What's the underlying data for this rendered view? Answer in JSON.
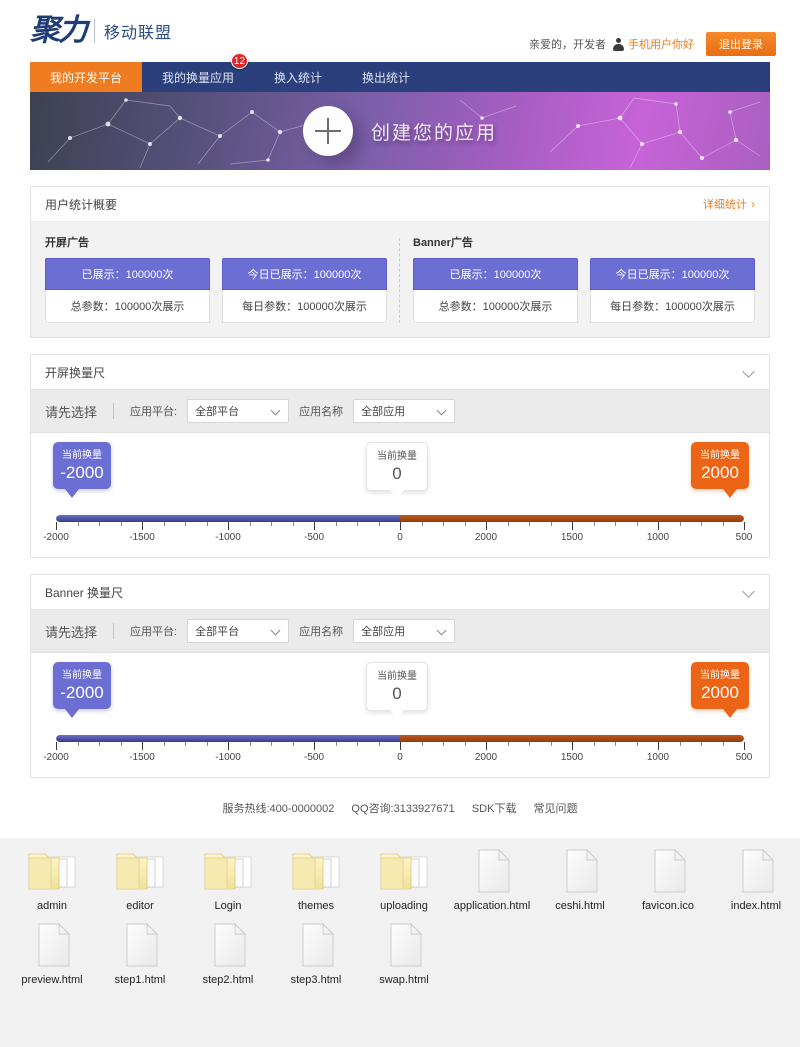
{
  "header": {
    "logo_mark": "聚力",
    "logo_sub": "移动联盟",
    "greeting": "亲爱的，开发者",
    "username": "手机用户你好",
    "logout_label": "退出登录",
    "avatar_icon": "user-avatar-icon"
  },
  "nav": {
    "items": [
      {
        "label": "我的开发平台",
        "active": true,
        "badge": ""
      },
      {
        "label": "我的换量应用",
        "active": false,
        "badge": "12"
      },
      {
        "label": "换入统计",
        "active": false,
        "badge": ""
      },
      {
        "label": "换出统计",
        "active": false,
        "badge": ""
      }
    ]
  },
  "hero": {
    "plus_icon": "plus-circle-icon",
    "text": "创建您的应用"
  },
  "stats": {
    "title": "用户统计概要",
    "more_label": "详细统计",
    "more_icon": "chevron-right-icon",
    "groups": [
      {
        "label": "开屏广告",
        "boxes": [
          {
            "top": "已展示：100000次",
            "bottom": "总参数：100000次展示"
          },
          {
            "top": "今日已展示：100000次",
            "bottom": "每日参数：100000次展示"
          }
        ]
      },
      {
        "label": "Banner广告",
        "boxes": [
          {
            "top": "已展示：100000次",
            "bottom": "总参数：100000次展示"
          },
          {
            "top": "今日已展示：100000次",
            "bottom": "每日参数：100000次展示"
          }
        ]
      }
    ]
  },
  "sections": [
    {
      "title": "开屏换量尺",
      "collapse_icon": "chevron-down-icon",
      "filters": {
        "title": "请先选择",
        "platform_label": "应用平台:",
        "platform_value": "全部平台",
        "app_label": "应用名称",
        "app_value": "全部应用",
        "dropdown_icon": "chevron-down-icon"
      },
      "slider": {
        "bubbles": [
          {
            "label": "当前换量",
            "value": "-2000",
            "color": "blue"
          },
          {
            "label": "当前换量",
            "value": "0",
            "color": "white"
          },
          {
            "label": "当前换量",
            "value": "2000",
            "color": "orange"
          }
        ],
        "tick_labels": [
          "-2000",
          "-1500",
          "-1000",
          "-500",
          "0",
          "2000",
          "1500",
          "1000",
          "500"
        ],
        "track_left_color": "#3a3e86",
        "track_right_color": "#8e3d0e"
      }
    },
    {
      "title": "Banner 换量尺",
      "collapse_icon": "chevron-down-icon",
      "filters": {
        "title": "请先选择",
        "platform_label": "应用平台:",
        "platform_value": "全部平台",
        "app_label": "应用名称",
        "app_value": "全部应用",
        "dropdown_icon": "chevron-down-icon"
      },
      "slider": {
        "bubbles": [
          {
            "label": "当前换量",
            "value": "-2000",
            "color": "blue"
          },
          {
            "label": "当前换量",
            "value": "0",
            "color": "white"
          },
          {
            "label": "当前换量",
            "value": "2000",
            "color": "orange"
          }
        ],
        "tick_labels": [
          "-2000",
          "-1500",
          "-1000",
          "-500",
          "0",
          "2000",
          "1500",
          "1000",
          "500"
        ],
        "track_left_color": "#3a3e86",
        "track_right_color": "#8e3d0e"
      }
    }
  ],
  "footer": {
    "hotline": "服务热线:400-0000002",
    "qq": "QQ咨询:3133927671",
    "sdk": "SDK下载",
    "faq": "常见问题"
  },
  "desktop": {
    "row1": [
      {
        "name": "admin",
        "type": "folder"
      },
      {
        "name": "editor",
        "type": "folder"
      },
      {
        "name": "Login",
        "type": "folder"
      },
      {
        "name": "themes",
        "type": "folder"
      },
      {
        "name": "uploading",
        "type": "folder"
      },
      {
        "name": "application.html",
        "type": "file"
      },
      {
        "name": "ceshi.html",
        "type": "file"
      },
      {
        "name": "favicon.ico",
        "type": "file"
      },
      {
        "name": "index.html",
        "type": "file"
      }
    ],
    "row2": [
      {
        "name": "preview.html",
        "type": "file"
      },
      {
        "name": "step1.html",
        "type": "file"
      },
      {
        "name": "step2.html",
        "type": "file"
      },
      {
        "name": "step3.html",
        "type": "file"
      },
      {
        "name": "swap.html",
        "type": "file"
      }
    ]
  },
  "chart_data": {
    "type": "bar",
    "title": "用户统计概要",
    "categories": [
      "开屏广告-已展示",
      "开屏广告-今日已展示",
      "Banner广告-已展示",
      "Banner广告-今日已展示"
    ],
    "values": [
      100000,
      100000,
      100000,
      100000
    ],
    "xlabel": "",
    "ylabel": "次展示",
    "ylim": [
      0,
      100000
    ]
  }
}
